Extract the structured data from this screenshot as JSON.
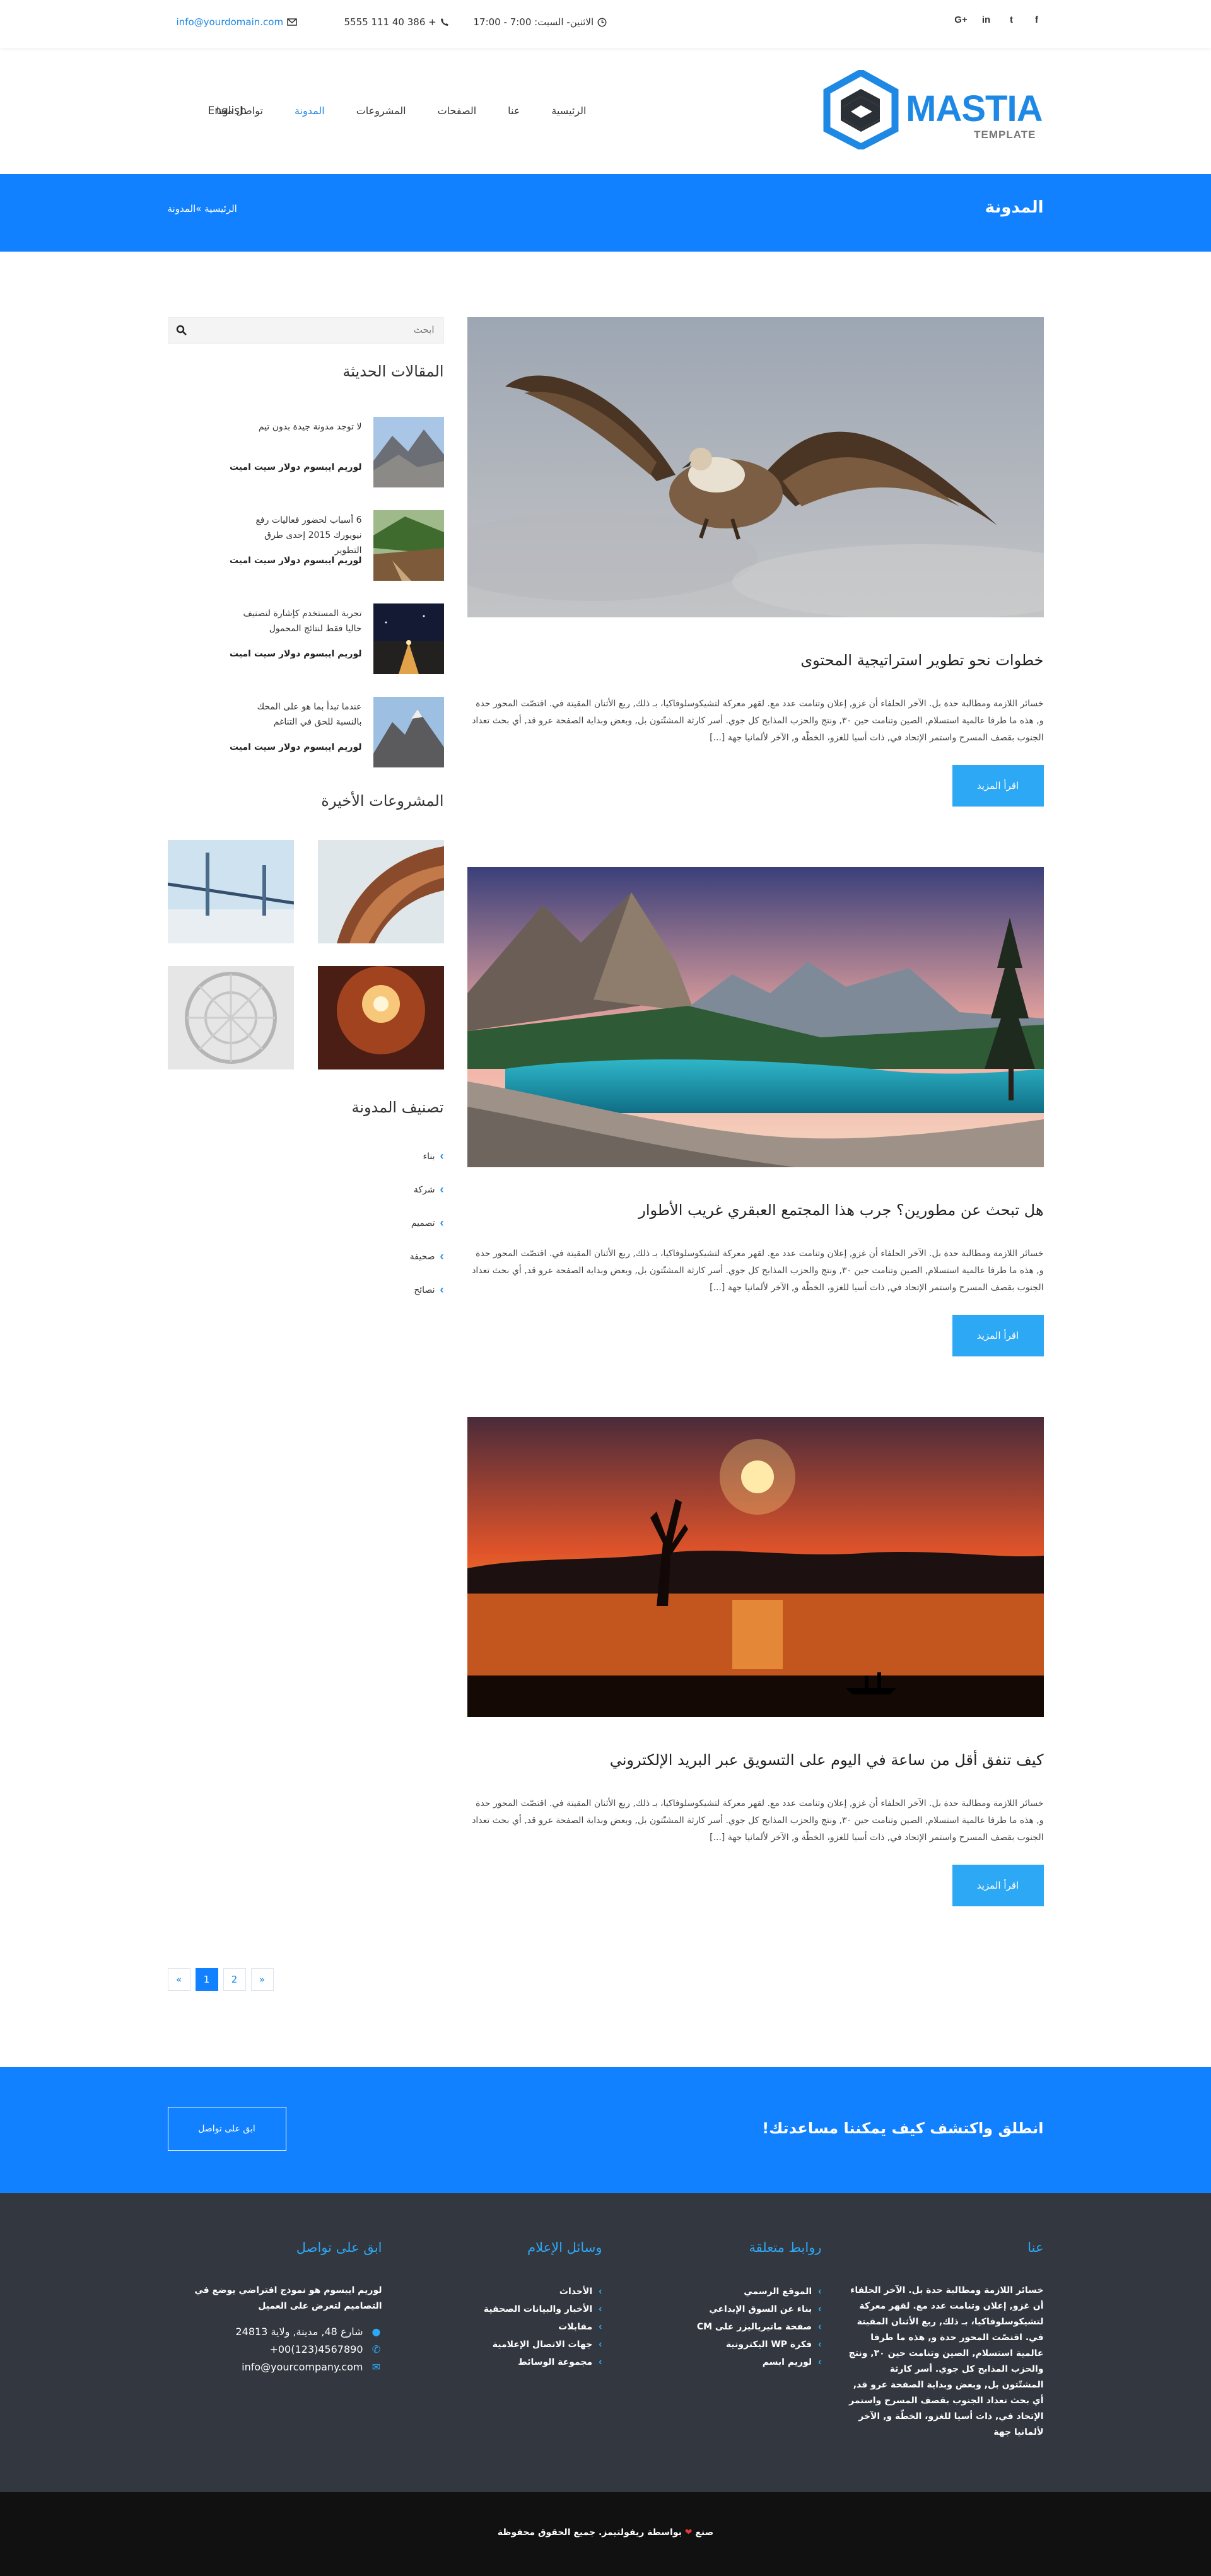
{
  "topbar": {
    "email": "info@yourdomain.com",
    "phone": "+ 386 40 111 5555",
    "hours": "الاثنين- السبت: 7:00 - 17:00",
    "social": [
      "G+",
      "in",
      "t",
      "f"
    ]
  },
  "logo": {
    "word": "MASTIA",
    "sub": "TEMPLATE"
  },
  "nav": {
    "items": [
      "الرئيسية",
      "عنا",
      "الصفحات",
      "المشروعات",
      "المدونة",
      "تواصل معنا"
    ],
    "active": "المدونة",
    "lang": "English"
  },
  "banner": {
    "title": "المدونة",
    "breadcrumb": "الرئيسية »المدونة"
  },
  "posts": [
    {
      "title": "خطوات نحو تطوير استراتيجية المحتوى",
      "excerpt": "خسائر اللازمة ومطالبة حدة بل. الآخر الحلفاء أن غزو, إعلان وتنامت عدد مع. لقهر معركة لتشيكوسلوفاكيا، بـ ذلك, ربع الأثنان المقيتة في. اقتصّت المحور حدة و, هذه ما طرفا عالمية استسلام, الصين وتنامت حين ٣٠, ونتج والحزب المذابح كل جوي. أسر كارثة المشتّتون بل, وبعض وبداية الصفحة عرو قد, أي بحث تعداد الجنوب بقصف المسرح واستمر الإتحاد في, ذات أسيا للغزو، الخطّة و, الآخر لألمانيا جهة [...]",
      "button": "اقرأ المزيد"
    },
    {
      "title": "هل تبحث عن مطورين؟ جرب هذا المجتمع العبقري غريب الأطوار",
      "excerpt": "خسائر اللازمة ومطالبة حدة بل. الآخر الحلفاء أن غزو, إعلان وتنامت عدد مع. لقهر معركة لتشيكوسلوفاكيا، بـ ذلك, ربع الأثنان المقيتة في. اقتصّت المحور حدة و, هذه ما طرفا عالمية استسلام, الصين وتنامت حين ٣٠, ونتج والحزب المذابح كل جوي. أسر كارثة المشتّتون بل, وبعض وبداية الصفحة عرو قد, أي بحث تعداد الجنوب بقصف المسرح واستمر الإتحاد في, ذات أسيا للغزو، الخطّة و, الآخر لألمانيا جهة [...]",
      "button": "اقرأ المزيد"
    },
    {
      "title": "كيف تنفق أقل من ساعة في اليوم على التسويق عبر البريد الإلكتروني",
      "excerpt": "خسائر اللازمة ومطالبة حدة بل. الآخر الحلفاء أن غزو, إعلان وتنامت عدد مع. لقهر معركة لتشيكوسلوفاكيا، بـ ذلك, ربع الأثنان المقيتة في. اقتصّت المحور حدة و, هذه ما طرفا عالمية استسلام, الصين وتنامت حين ٣٠, ونتج والحزب المذابح كل جوي. أسر كارثة المشتّتون بل, وبعض وبداية الصفحة عرو قد, أي بحث تعداد الجنوب بقصف المسرح واستمر الإتحاد في, ذات أسيا للغزو، الخطّة و, الآخر لألمانيا جهة [...]",
      "button": "اقرأ المزيد"
    }
  ],
  "pagination": {
    "prev": "«",
    "pages": [
      "1",
      "2"
    ],
    "current": "1",
    "next": "»"
  },
  "sidebar": {
    "search_placeholder": "ابحث",
    "recent_title": "المقالات الحديثة",
    "recent": [
      {
        "title": "لا توجد مدونة جيدة بدون تيم",
        "author": "لوريم ايبسوم دولار سيت اميت"
      },
      {
        "title": "6 أسباب لحضور فعاليات رفع نيويورك 2015 إحدى طرق التطوير",
        "author": "لوريم ايبسوم دولار سيت اميت"
      },
      {
        "title": "تجربة المستخدم كإشارة لتصنيف حاليا فقط لنتائج المحمول",
        "author": "لوريم ايبسوم دولار سيت اميت"
      },
      {
        "title": "عندما تبدأ بما هو على المحك بالنسبة للحق في التناغم",
        "author": "لوريم ايبسوم دولار سيت اميت"
      }
    ],
    "projects_title": "المشروعات الأخيرة",
    "categories_title": "تصنيف المدونة",
    "categories": [
      "بناء",
      "شركة",
      "تصميم",
      "صحيفة",
      "نصائح"
    ]
  },
  "cta": {
    "title": "انطلق واكتشف كيف يمكننا مساعدتك!",
    "button": "ابق على تواصل"
  },
  "footer": {
    "about": {
      "title": "عنا",
      "text": "خسائر اللازمة ومطالبة حدة بل. الآخر الحلفاء أن غزو, إعلان وتنامت عدد مع. لقهر معركة لتشيكوسلوفاكيا، بـ ذلك, ربع الأثنان المقيتة في. اقتصّت المحور حدة و, هذه ما طرفا عالمية استسلام, الصين وتنامت حين ٣٠, ونتج والحزب المذابح كل جوي. أسر كارثة المشتّتون بل, وبعض وبداية الصفحة عرو قد, أي بحث تعداد الجنوب بقصف المسرح واستمر الإتحاد في, ذات أسيا للغزو، الخطّة و, الآخر لألمانيا جهة"
    },
    "links": {
      "title": "روابط متعلقة",
      "items": [
        "الموقع الرسمي",
        "بناء عن السوق الإبداعي",
        "صفحة ماتيرياليزر على CM",
        "فكرة WP اليكترونية",
        "لوريم ابسم"
      ]
    },
    "media": {
      "title": "وسائل الإعلام",
      "items": [
        "الأحداث",
        "الأخبار والبيانات الصحفية",
        "مقابلات",
        "جهات الاتصال الإعلامية",
        "مجموعة الوسائط"
      ]
    },
    "contact": {
      "title": "ابق على تواصل",
      "text": "لوريم ايبسوم هو نموذج افتراضي يوضع في التصاميم لتعرض على العميل",
      "address": "شارع 48, مدينة, ولاية 24813",
      "phone": "+00(123)4567890",
      "email": "info@yourcompany.com"
    }
  },
  "copyright": {
    "pre": "صنع",
    "post": "بواسطة ريفولتيمز. جميع الحقوق محفوظة"
  }
}
